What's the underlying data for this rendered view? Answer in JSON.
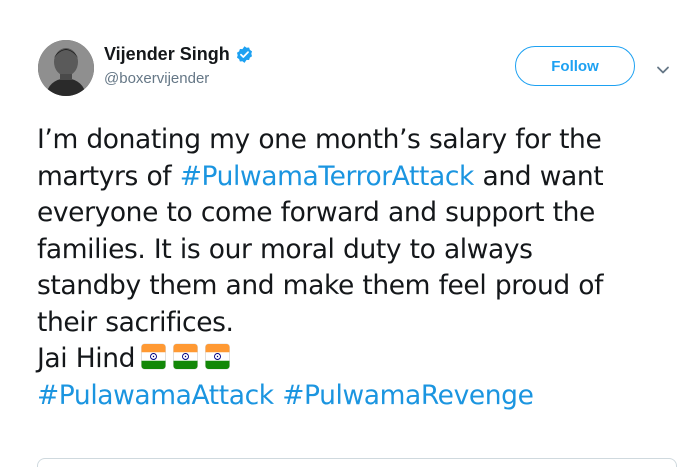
{
  "author": {
    "display_name": "Vijender Singh",
    "handle": "@boxervijender",
    "verified": true
  },
  "follow_button": {
    "label": "Follow"
  },
  "tweet": {
    "lines": [
      [
        "I’m donating my one month’s salary for the"
      ],
      [
        "martyrs of ",
        "#PulwamaTerrorAttack",
        " and want"
      ],
      [
        "everyone to come forward and support the"
      ],
      [
        "families. It is our moral duty to always"
      ],
      [
        "standby them and make them feel proud of"
      ],
      [
        "their sacrifices."
      ]
    ],
    "sign_off": "Jai Hind",
    "flag_emoji": [
      "🇮🇳",
      "🇮🇳",
      "🇮🇳"
    ],
    "hashtags": [
      "#PulawamaAttack",
      "#PulwamaRevenge"
    ]
  },
  "colors": {
    "link": "#1b95e0",
    "follow_accent": "#1da1f2",
    "secondary_text": "#657786",
    "flag_saffron": "#ff9933",
    "flag_white": "#ffffff",
    "flag_green": "#138808",
    "flag_chakra": "#000080"
  },
  "icons": {
    "verified": "verified-badge-icon",
    "caret": "chevron-down-icon"
  }
}
